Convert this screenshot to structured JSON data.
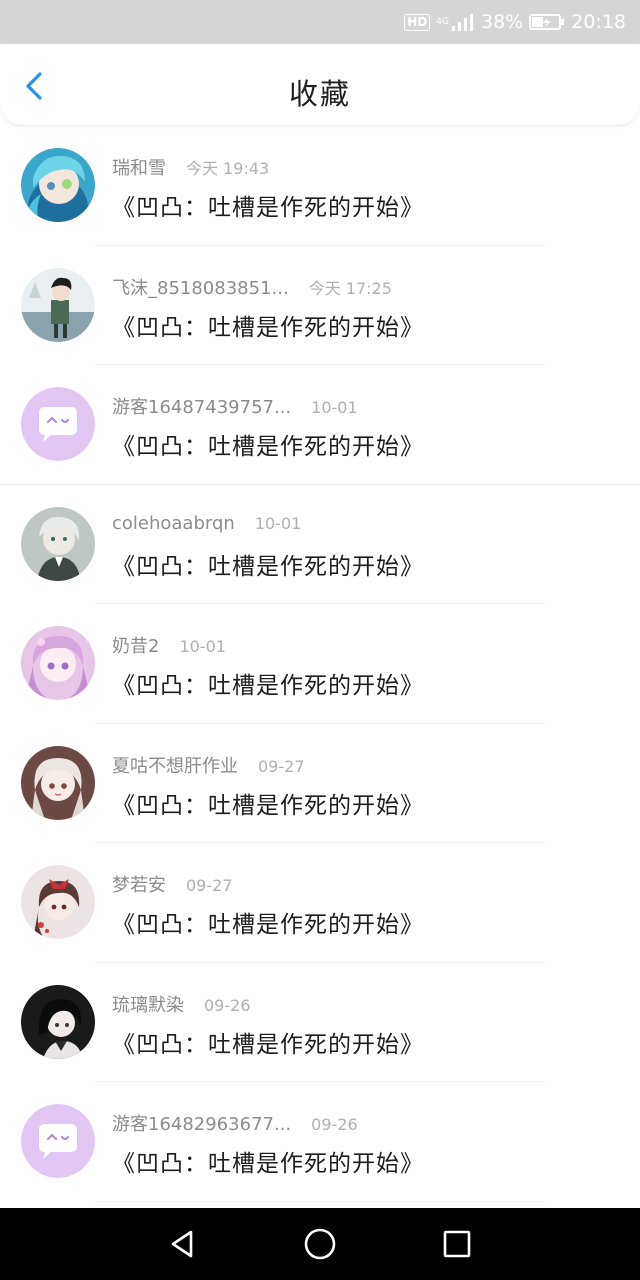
{
  "status_bar": {
    "hd_badge": "HD",
    "network": "4G",
    "battery_percent": "38%",
    "time": "20:18",
    "icons": [
      "hd-icon",
      "signal-icon",
      "battery-icon"
    ]
  },
  "header": {
    "title": "收藏",
    "back_icon": "chevron-left-icon",
    "accent_color": "#2d8cf0"
  },
  "favorites": [
    {
      "user": "瑞和雪",
      "time": "今天 19:43",
      "title": "《凹凸：吐槽是作死的开始》",
      "avatar": "anime-avatar-teal"
    },
    {
      "user": "飞沫_8518083851...",
      "time": "今天 17:25",
      "title": "《凹凸：吐槽是作死的开始》",
      "avatar": "anime-avatar-boy"
    },
    {
      "user": "游客16487439757...",
      "time": "10-01",
      "title": "《凹凸：吐槽是作死的开始》",
      "avatar": "default-chat-avatar"
    },
    {
      "user": "colehoaabrqn",
      "time": "10-01",
      "title": "《凹凸：吐槽是作死的开始》",
      "avatar": "anime-avatar-grey"
    },
    {
      "user": "奶昔2",
      "time": "10-01",
      "title": "《凹凸：吐槽是作死的开始》",
      "avatar": "anime-avatar-pink"
    },
    {
      "user": "夏咕不想肝作业",
      "time": "09-27",
      "title": "《凹凸：吐槽是作死的开始》",
      "avatar": "anime-avatar-white-hair"
    },
    {
      "user": "梦若安",
      "time": "09-27",
      "title": "《凹凸：吐槽是作死的开始》",
      "avatar": "anime-avatar-red-bow"
    },
    {
      "user": "琉璃默染",
      "time": "09-26",
      "title": "《凹凸：吐槽是作死的开始》",
      "avatar": "anime-avatar-dark"
    },
    {
      "user": "游客16482963677...",
      "time": "09-26",
      "title": "《凹凸：吐槽是作死的开始》",
      "avatar": "default-chat-avatar"
    }
  ],
  "nav_bar": {
    "icons": [
      "back-triangle-icon",
      "home-circle-icon",
      "recents-square-icon"
    ]
  }
}
